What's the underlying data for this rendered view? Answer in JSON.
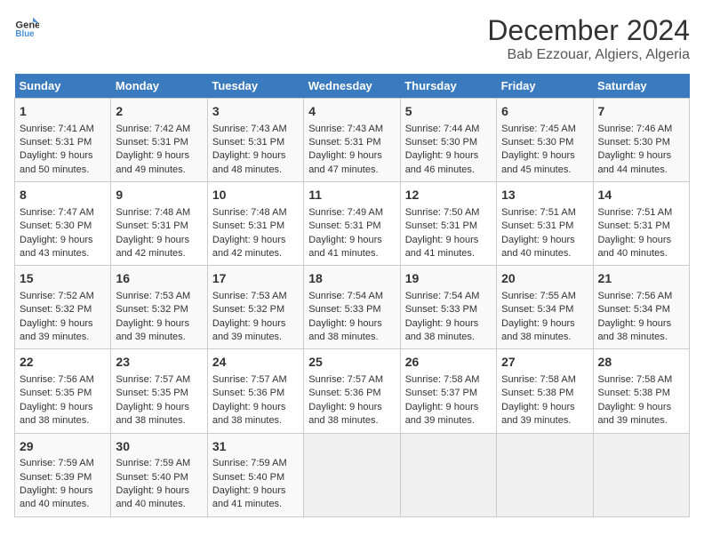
{
  "header": {
    "logo_line1": "General",
    "logo_line2": "Blue",
    "title": "December 2024",
    "subtitle": "Bab Ezzouar, Algiers, Algeria"
  },
  "days_of_week": [
    "Sunday",
    "Monday",
    "Tuesday",
    "Wednesday",
    "Thursday",
    "Friday",
    "Saturday"
  ],
  "weeks": [
    [
      {
        "day": "1",
        "info": "Sunrise: 7:41 AM\nSunset: 5:31 PM\nDaylight: 9 hours and 50 minutes."
      },
      {
        "day": "2",
        "info": "Sunrise: 7:42 AM\nSunset: 5:31 PM\nDaylight: 9 hours and 49 minutes."
      },
      {
        "day": "3",
        "info": "Sunrise: 7:43 AM\nSunset: 5:31 PM\nDaylight: 9 hours and 48 minutes."
      },
      {
        "day": "4",
        "info": "Sunrise: 7:43 AM\nSunset: 5:31 PM\nDaylight: 9 hours and 47 minutes."
      },
      {
        "day": "5",
        "info": "Sunrise: 7:44 AM\nSunset: 5:30 PM\nDaylight: 9 hours and 46 minutes."
      },
      {
        "day": "6",
        "info": "Sunrise: 7:45 AM\nSunset: 5:30 PM\nDaylight: 9 hours and 45 minutes."
      },
      {
        "day": "7",
        "info": "Sunrise: 7:46 AM\nSunset: 5:30 PM\nDaylight: 9 hours and 44 minutes."
      }
    ],
    [
      {
        "day": "8",
        "info": "Sunrise: 7:47 AM\nSunset: 5:30 PM\nDaylight: 9 hours and 43 minutes."
      },
      {
        "day": "9",
        "info": "Sunrise: 7:48 AM\nSunset: 5:31 PM\nDaylight: 9 hours and 42 minutes."
      },
      {
        "day": "10",
        "info": "Sunrise: 7:48 AM\nSunset: 5:31 PM\nDaylight: 9 hours and 42 minutes."
      },
      {
        "day": "11",
        "info": "Sunrise: 7:49 AM\nSunset: 5:31 PM\nDaylight: 9 hours and 41 minutes."
      },
      {
        "day": "12",
        "info": "Sunrise: 7:50 AM\nSunset: 5:31 PM\nDaylight: 9 hours and 41 minutes."
      },
      {
        "day": "13",
        "info": "Sunrise: 7:51 AM\nSunset: 5:31 PM\nDaylight: 9 hours and 40 minutes."
      },
      {
        "day": "14",
        "info": "Sunrise: 7:51 AM\nSunset: 5:31 PM\nDaylight: 9 hours and 40 minutes."
      }
    ],
    [
      {
        "day": "15",
        "info": "Sunrise: 7:52 AM\nSunset: 5:32 PM\nDaylight: 9 hours and 39 minutes."
      },
      {
        "day": "16",
        "info": "Sunrise: 7:53 AM\nSunset: 5:32 PM\nDaylight: 9 hours and 39 minutes."
      },
      {
        "day": "17",
        "info": "Sunrise: 7:53 AM\nSunset: 5:32 PM\nDaylight: 9 hours and 39 minutes."
      },
      {
        "day": "18",
        "info": "Sunrise: 7:54 AM\nSunset: 5:33 PM\nDaylight: 9 hours and 38 minutes."
      },
      {
        "day": "19",
        "info": "Sunrise: 7:54 AM\nSunset: 5:33 PM\nDaylight: 9 hours and 38 minutes."
      },
      {
        "day": "20",
        "info": "Sunrise: 7:55 AM\nSunset: 5:34 PM\nDaylight: 9 hours and 38 minutes."
      },
      {
        "day": "21",
        "info": "Sunrise: 7:56 AM\nSunset: 5:34 PM\nDaylight: 9 hours and 38 minutes."
      }
    ],
    [
      {
        "day": "22",
        "info": "Sunrise: 7:56 AM\nSunset: 5:35 PM\nDaylight: 9 hours and 38 minutes."
      },
      {
        "day": "23",
        "info": "Sunrise: 7:57 AM\nSunset: 5:35 PM\nDaylight: 9 hours and 38 minutes."
      },
      {
        "day": "24",
        "info": "Sunrise: 7:57 AM\nSunset: 5:36 PM\nDaylight: 9 hours and 38 minutes."
      },
      {
        "day": "25",
        "info": "Sunrise: 7:57 AM\nSunset: 5:36 PM\nDaylight: 9 hours and 38 minutes."
      },
      {
        "day": "26",
        "info": "Sunrise: 7:58 AM\nSunset: 5:37 PM\nDaylight: 9 hours and 39 minutes."
      },
      {
        "day": "27",
        "info": "Sunrise: 7:58 AM\nSunset: 5:38 PM\nDaylight: 9 hours and 39 minutes."
      },
      {
        "day": "28",
        "info": "Sunrise: 7:58 AM\nSunset: 5:38 PM\nDaylight: 9 hours and 39 minutes."
      }
    ],
    [
      {
        "day": "29",
        "info": "Sunrise: 7:59 AM\nSunset: 5:39 PM\nDaylight: 9 hours and 40 minutes."
      },
      {
        "day": "30",
        "info": "Sunrise: 7:59 AM\nSunset: 5:40 PM\nDaylight: 9 hours and 40 minutes."
      },
      {
        "day": "31",
        "info": "Sunrise: 7:59 AM\nSunset: 5:40 PM\nDaylight: 9 hours and 41 minutes."
      },
      {
        "day": "",
        "info": ""
      },
      {
        "day": "",
        "info": ""
      },
      {
        "day": "",
        "info": ""
      },
      {
        "day": "",
        "info": ""
      }
    ]
  ]
}
